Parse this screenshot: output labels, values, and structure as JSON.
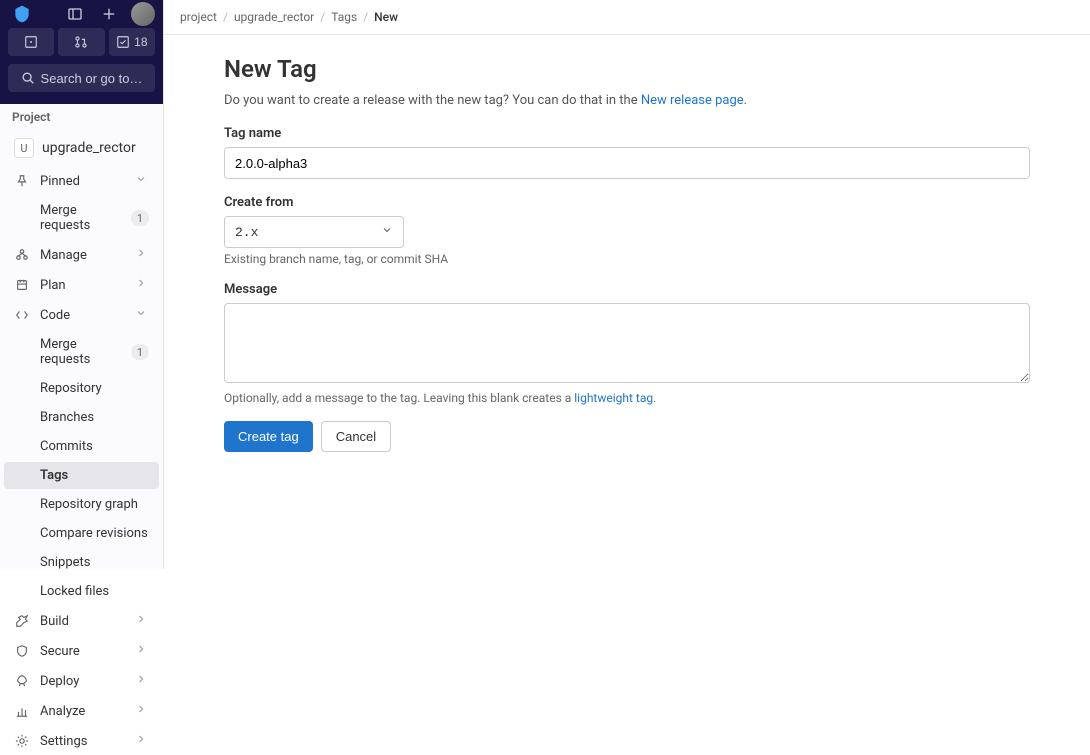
{
  "topbar": {
    "search_label": "Search or go to…",
    "todo_count": "18"
  },
  "sidebar": {
    "section_title": "Project",
    "project_name": "upgrade_rector",
    "project_initial": "U",
    "pinned": {
      "label": "Pinned"
    },
    "pinned_items": [
      {
        "label": "Merge requests",
        "badge": "1"
      }
    ],
    "nav": {
      "manage": "Manage",
      "plan": "Plan",
      "code": "Code",
      "build": "Build",
      "secure": "Secure",
      "deploy": "Deploy",
      "analyze": "Analyze",
      "settings": "Settings"
    },
    "code_items": {
      "merge_requests": "Merge requests",
      "merge_requests_badge": "1",
      "repository": "Repository",
      "branches": "Branches",
      "commits": "Commits",
      "tags": "Tags",
      "repository_graph": "Repository graph",
      "compare": "Compare revisions",
      "snippets": "Snippets",
      "locked": "Locked files"
    }
  },
  "breadcrumbs": {
    "root": "project",
    "project": "upgrade_rector",
    "tags": "Tags",
    "current": "New"
  },
  "page": {
    "title": "New Tag",
    "subtitle_prefix": "Do you want to create a release with the new tag? You can do that in the ",
    "subtitle_link": "New release page",
    "tag_name_label": "Tag name",
    "tag_name_value": "2.0.0-alpha3",
    "create_from_label": "Create from",
    "create_from_value": "2.x",
    "create_from_hint": "Existing branch name, tag, or commit SHA",
    "message_label": "Message",
    "message_hint_prefix": "Optionally, add a message to the tag. Leaving this blank creates a ",
    "message_hint_link": "lightweight tag",
    "submit": "Create tag",
    "cancel": "Cancel"
  }
}
